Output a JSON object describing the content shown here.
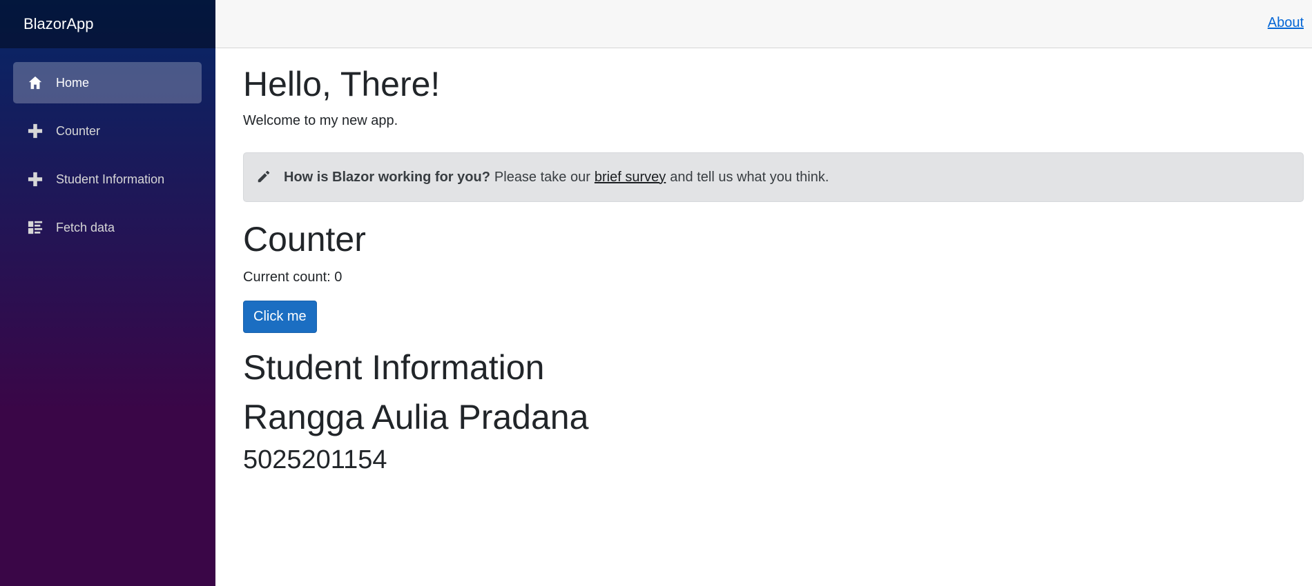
{
  "sidebar": {
    "brand": "BlazorApp",
    "items": [
      {
        "label": "Home",
        "icon": "home-icon",
        "active": true
      },
      {
        "label": "Counter",
        "icon": "plus-icon",
        "active": false
      },
      {
        "label": "Student Information",
        "icon": "plus-icon",
        "active": false
      },
      {
        "label": "Fetch data",
        "icon": "list-icon",
        "active": false
      }
    ]
  },
  "topbar": {
    "about_label": "About"
  },
  "main": {
    "title": "Hello, There!",
    "welcome": "Welcome to my new app.",
    "survey": {
      "icon": "pencil-icon",
      "question": "How is Blazor working for you?",
      "text_before": "Please take our",
      "link_label": "brief survey",
      "text_after": "and tell us what you think."
    },
    "counter": {
      "title": "Counter",
      "current_count": "Current count: 0",
      "button_label": "Click me"
    },
    "student": {
      "title": "Student Information",
      "name": "Rangga Aulia Pradana",
      "id": "5025201154"
    }
  },
  "colors": {
    "sidebar_gradient_top": "#052767",
    "sidebar_gradient_bottom": "#3a0647",
    "primary_button": "#1b6ec2",
    "link": "#0366d6",
    "alert_bg": "#e2e3e5"
  }
}
